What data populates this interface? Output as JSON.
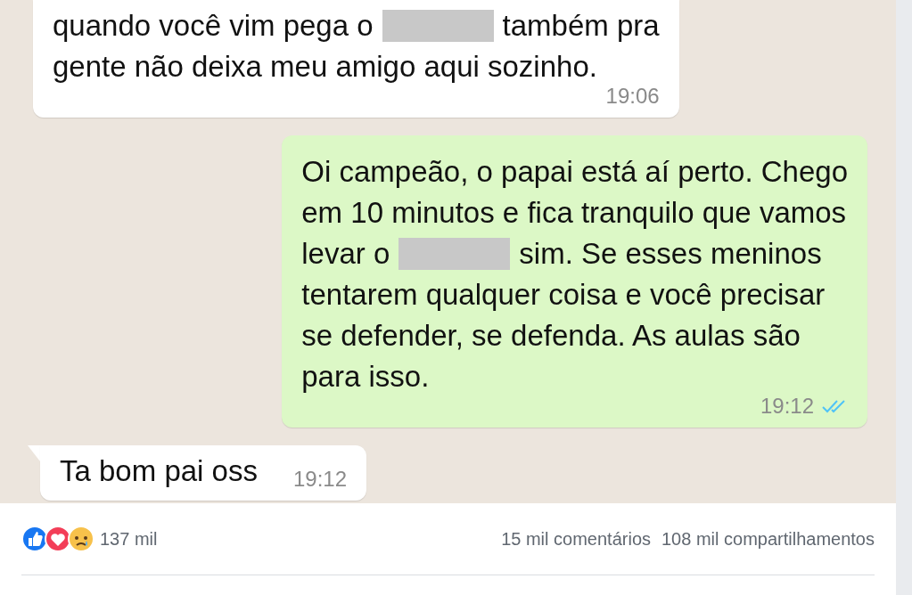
{
  "chat": {
    "messages": [
      {
        "kind": "incoming",
        "tail": false,
        "time": "19:06",
        "lines": [
          [
            {
              "kind": "text",
              "text": "quando você vim pega o"
            },
            {
              "kind": "redacted"
            },
            {
              "kind": "text",
              "text": "também pra"
            }
          ],
          [
            {
              "kind": "text",
              "text": "gente não deixa meu amigo aqui sozinho."
            }
          ]
        ]
      },
      {
        "kind": "outgoing",
        "tail": false,
        "time": "19:12",
        "read": true,
        "lines": [
          [
            {
              "kind": "text",
              "text": "Oi campeão, o papai está aí perto. Chego"
            }
          ],
          [
            {
              "kind": "text",
              "text": "em 10 minutos e fica tranquilo que vamos"
            }
          ],
          [
            {
              "kind": "text",
              "text": "levar o"
            },
            {
              "kind": "redacted"
            },
            {
              "kind": "text",
              "text": "sim. Se esses meninos"
            }
          ],
          [
            {
              "kind": "text",
              "text": "tentarem qualquer coisa e você precisar"
            }
          ],
          [
            {
              "kind": "text",
              "text": "se defender, se defenda. As aulas são"
            }
          ],
          [
            {
              "kind": "text",
              "text": "para isso."
            }
          ]
        ]
      },
      {
        "kind": "incoming",
        "tail": true,
        "time": "19:12",
        "lines": [
          [
            {
              "kind": "text",
              "text": "Ta bom pai oss"
            }
          ]
        ]
      }
    ]
  },
  "post_stats": {
    "reaction_count": "137 mil",
    "comments": "15 mil comentários",
    "shares": "108 mil compartilhamentos"
  }
}
